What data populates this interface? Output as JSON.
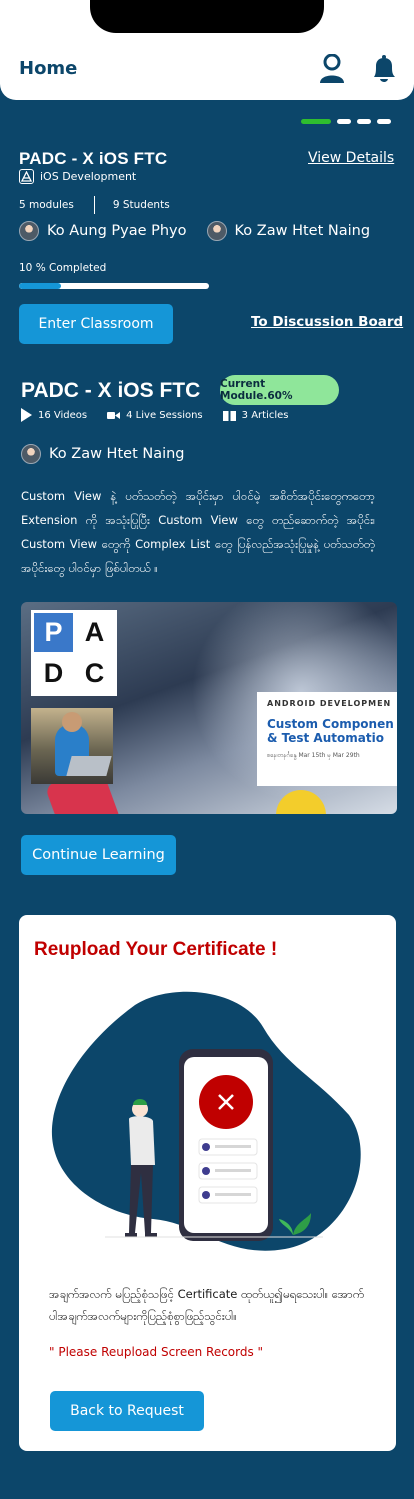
{
  "header": {
    "title": "Home",
    "profile_icon": "user-icon",
    "notification_icon": "bell-icon"
  },
  "pager": {
    "count": 4,
    "active": 0
  },
  "course": {
    "title": "PADC - X iOS FTC",
    "view_details": "View Details",
    "category": "iOS Development",
    "modules": "5 modules",
    "students": "9 Students",
    "mentors": [
      "Ko Aung Pyae Phyo",
      "Ko Zaw Htet Naing"
    ],
    "progress_label": "10 % Completed",
    "progress_percent": 10,
    "enter_button": "Enter Classroom",
    "discussion_link": "To Discussion Board"
  },
  "module": {
    "title": "PADC - X iOS FTC",
    "badge": "Current Module.60%",
    "videos": "16 Videos",
    "live_sessions": "4 Live Sessions",
    "articles": "3 Articles",
    "mentor": "Ko Zaw Htet Naing",
    "description": "Custom View နဲ့ ပတ်သတ်တဲ့ အပိုင်းမှာ ပါဝင်မဲ့ အစိတ်အပိုင်းတွေကတော့ Extension ကို အသုံးပြုပြီး Custom View တွေ တည်ဆောက်တဲ့ အပိုင်း၊Custom View တွေကို Complex List တွေ ပြန်လည်အသုံးပြုမှုနဲ့ ပတ်သတ်တဲ့အပိုင်းတွေ ပါဝင်မှာ ဖြစ်ပါတယ် ။",
    "thumbnail": {
      "logo_letters": [
        "P",
        "A",
        "D",
        "C"
      ],
      "banner_top": "ANDROID DEVELOPMEN",
      "banner_title_1": "Custom Componen",
      "banner_title_2": "& Test Automatio",
      "banner_dates": "စနေ၊တနင်္ဂနွေ Mar 15th မှ Mar 29th"
    },
    "continue_button": "Continue Learning"
  },
  "certificate": {
    "title": "Reupload Your Certificate !",
    "message": "အချက်အလက် မပြည့်စုံသဖြင့် Certificate ထုတ်ယူ၍မရသေးပါ။ အောက်ပါအချက်အလက်များကိုပြည့်စုံစွာဖြည့်သွင်းပါ။",
    "note": "\" Please Reupload Screen Records \"",
    "back_button": "Back to Request"
  },
  "colors": {
    "background": "#0c466a",
    "accent": "#1596d7",
    "active_dot": "#2fbd2f",
    "badge": "#8fe69a",
    "error": "#c00000"
  }
}
